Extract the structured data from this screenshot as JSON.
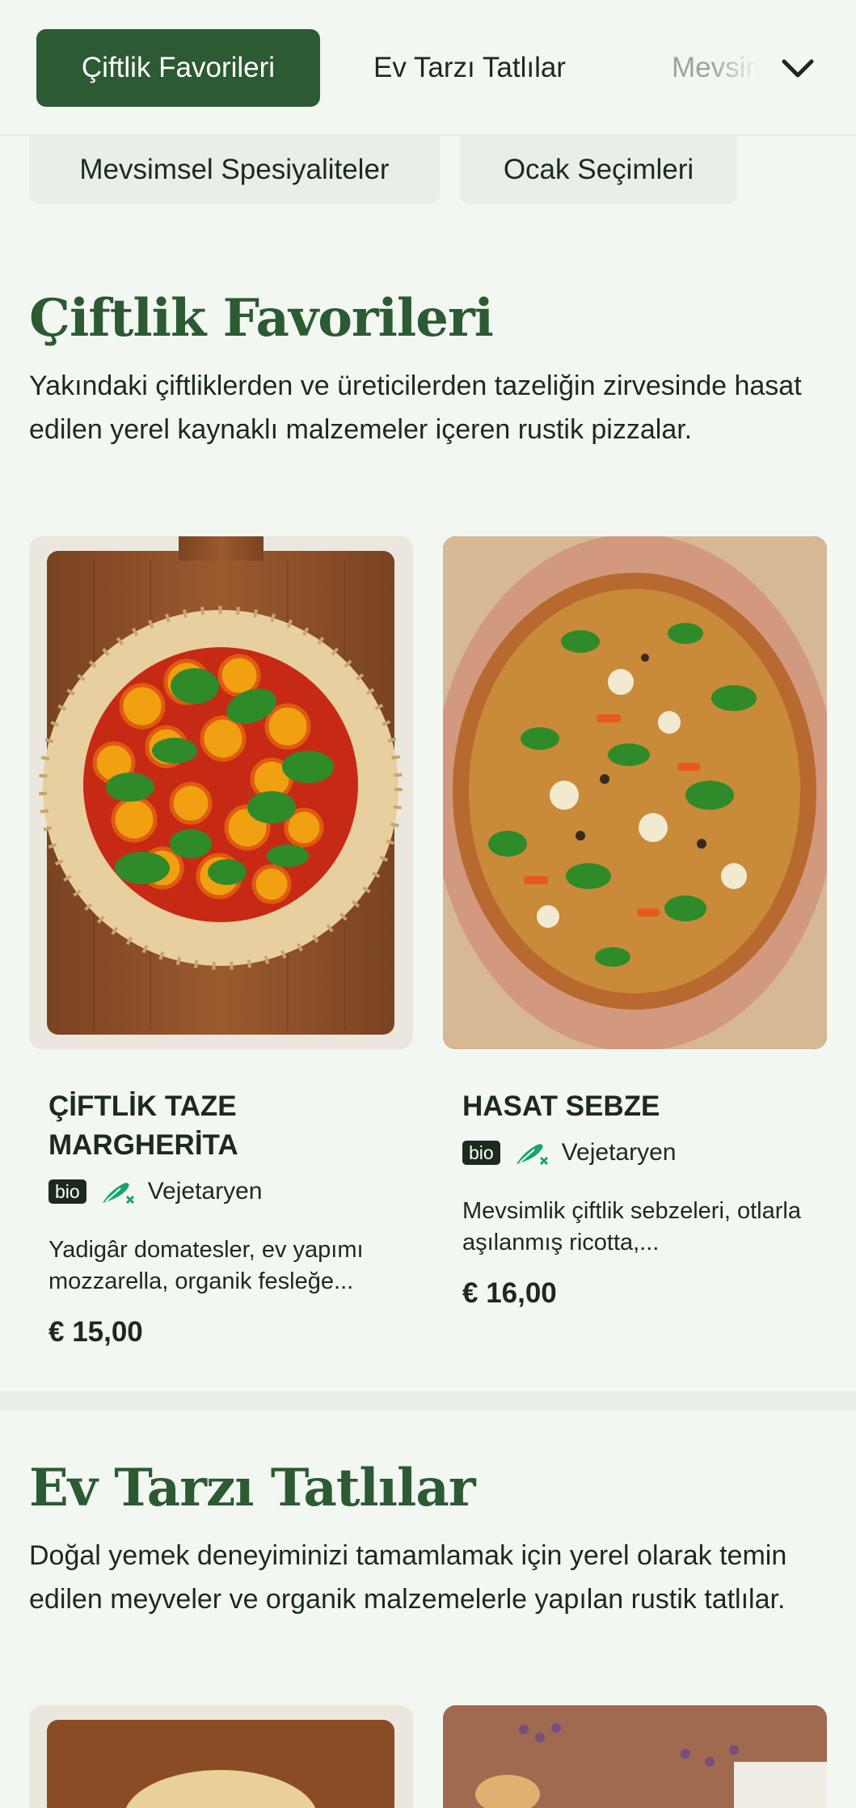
{
  "nav": {
    "tabs": [
      {
        "label": "Çiftlik Favorileri",
        "active": true
      },
      {
        "label": "Ev Tarzı Tatlılar"
      },
      {
        "label": "Mevsimsel Spesiyaliteler"
      }
    ],
    "more_icon": "chevron-down-icon",
    "second_row": [
      {
        "label": "Mevsimsel Spesiyaliteler"
      },
      {
        "label": "Ocak Seçimleri"
      }
    ]
  },
  "sections": [
    {
      "title": "Çiftlik Favorileri",
      "description": "Yakındaki çiftliklerden ve üreticilerden tazeliğin zirvesinde hasat edilen yerel kaynaklı malzemeler içeren rustik pizzalar.",
      "items": [
        {
          "title": "ÇİFTLİK TAZE MARGHERİTA",
          "badge": "bio",
          "diet": "Vejetaryen",
          "description": "Yadigâr domatesler, ev yapımı mozzarella, organik fesleğe...",
          "price": "€ 15,00"
        },
        {
          "title": "HASAT SEBZE",
          "badge": "bio",
          "diet": "Vejetaryen",
          "description": "Mevsimlik çiftlik sebzeleri, otlarla aşılanmış ricotta,...",
          "price": "€ 16,00"
        }
      ]
    },
    {
      "title": "Ev Tarzı Tatlılar",
      "description": "Doğal yemek deneyiminizi tamamlamak için yerel olarak temin edilen meyveler ve organik malzemelerle yapılan rustik tatlılar."
    }
  ],
  "colors": {
    "brand": "#2c5a32",
    "background": "#f3f7f2",
    "veg_icon": "#1aa36a"
  }
}
